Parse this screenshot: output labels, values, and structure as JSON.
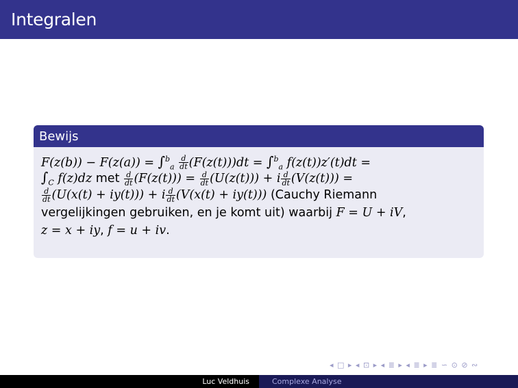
{
  "slide": {
    "title": "Integralen"
  },
  "block": {
    "title": "Bewijs",
    "lines": [
      {
        "p1": "F(z(b)) − F(z(a)) = ",
        "int1_up": "b",
        "int1_lo": "a",
        "frac_num": "d",
        "frac_den": "dt",
        "p2": "(F(z(t)))dt = ",
        "int2_up": "b",
        "int2_lo": "a",
        "p3": " f(z(t))z′(t)dt ="
      },
      {
        "int_lo": "C",
        "p1": " f(z)dz",
        "word": " met ",
        "f1_num": "d",
        "f1_den": "dt",
        "p2": "(F(z(t))) = ",
        "f2_num": "d",
        "f2_den": "dt",
        "p3": "(U(z(t))) + i",
        "f3_num": "d",
        "f3_den": "dt",
        "p4": "(V(z(t))) ="
      },
      {
        "f1_num": "d",
        "f1_den": "dt",
        "p1": "(U(x(t) + iy(t))) + i",
        "f2_num": "d",
        "f2_den": "dt",
        "p2": "(V(x(t) + iy(t)))",
        "word": " (Cauchy Riemann"
      },
      {
        "word": "vergelijkingen gebruiken, en je komt uit) waarbij ",
        "p1": "F = U + iV",
        "tail": ","
      },
      {
        "p1": "z = x + iy",
        "sep": ", ",
        "p2": "f = u + iv",
        "tail": "."
      }
    ]
  },
  "navigation": {
    "symbols": "◂ □ ▸ ◂ ⊡ ▸ ◂ ≣ ▸ ◂ ≣ ▸ ≣ ∽ ⊙ ⊘ ∾"
  },
  "footer": {
    "author": "Luc Veldhuis",
    "talk_title": "Complexe Analyse"
  },
  "colors": {
    "theme_blue": "#33338c",
    "block_body": "#ebebf4",
    "footer_dark": "#1a1a56"
  }
}
